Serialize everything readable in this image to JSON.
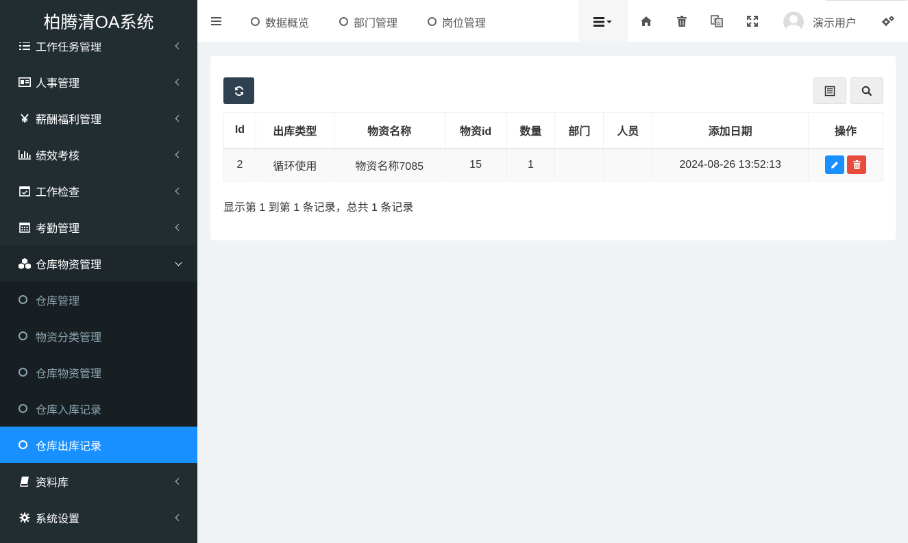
{
  "app": {
    "title": "柏腾清OA系统"
  },
  "sidebar": {
    "items": [
      {
        "label": "工作任务管理",
        "icon": "list-icon"
      },
      {
        "label": "人事管理",
        "icon": "id-card-icon"
      },
      {
        "label": "薪酬福利管理",
        "icon": "yen-icon"
      },
      {
        "label": "绩效考核",
        "icon": "bar-chart-icon"
      },
      {
        "label": "工作检查",
        "icon": "calendar-check-icon"
      },
      {
        "label": "考勤管理",
        "icon": "calendar-icon"
      },
      {
        "label": "仓库物资管理",
        "icon": "cubes-icon"
      }
    ],
    "submenu": [
      {
        "label": "仓库管理"
      },
      {
        "label": "物资分类管理"
      },
      {
        "label": "仓库物资管理"
      },
      {
        "label": "仓库入库记录"
      },
      {
        "label": "仓库出库记录"
      }
    ],
    "after": [
      {
        "label": "资料库",
        "icon": "book-icon"
      },
      {
        "label": "系统设置",
        "icon": "gear-icon"
      }
    ]
  },
  "header": {
    "tabs": [
      {
        "label": "数据概览"
      },
      {
        "label": "部门管理"
      },
      {
        "label": "岗位管理"
      }
    ],
    "user_name": "演示用户"
  },
  "table": {
    "columns": [
      "Id",
      "出库类型",
      "物资名称",
      "物资id",
      "数量",
      "部门",
      "人员",
      "添加日期",
      "操作"
    ],
    "rows": [
      [
        "2",
        "循环使用",
        "物资名称7085",
        "15",
        "1",
        "",
        "",
        "2024-08-26 13:52:13"
      ]
    ]
  },
  "summary": "显示第 1 到第 1 条记录，总共 1 条记录",
  "colors": {
    "sidebar_bg": "#222d32",
    "active": "#1890ff",
    "danger": "#e74c3c",
    "dark_btn": "#2f4050"
  }
}
